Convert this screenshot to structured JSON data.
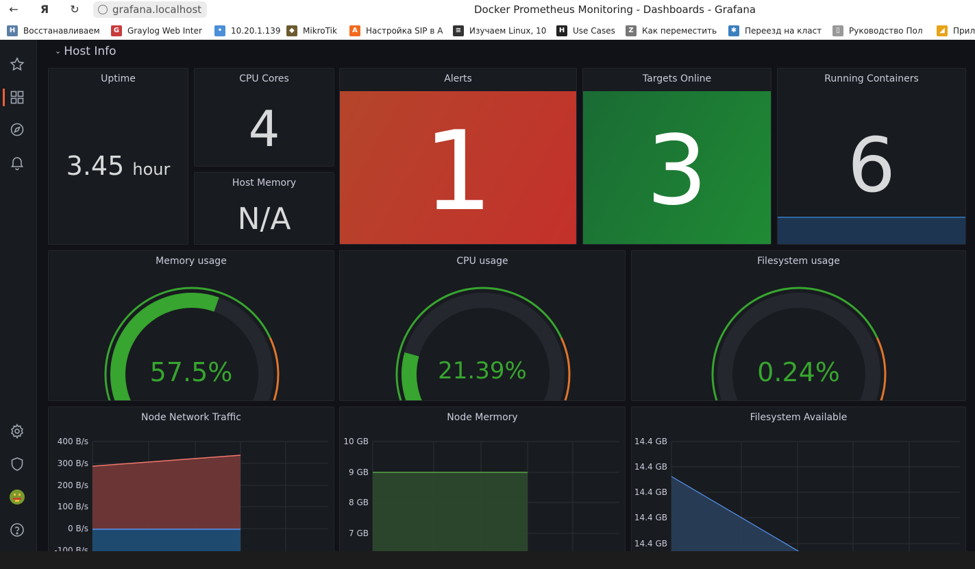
{
  "browser": {
    "url": "grafana.localhost",
    "window_title": "Docker Prometheus Monitoring - Dashboards - Grafana",
    "back_glyph": "←",
    "yandex_glyph": "Я",
    "reload_glyph": "↻"
  },
  "bookmarks": [
    {
      "label": "Восстанавливаем",
      "icon": "H",
      "color": "#5a7fa5"
    },
    {
      "label": "Graylog Web Inter",
      "icon": "G",
      "color": "#c93b3b"
    },
    {
      "label": "10.20.1.139",
      "icon": "•",
      "color": "#4a8fd8"
    },
    {
      "label": "MikroTik",
      "icon": "◆",
      "color": "#6b5b2e"
    },
    {
      "label": "Настройка SIP в А",
      "icon": "A",
      "color": "#f26b1d"
    },
    {
      "label": "Изучаем Linux, 10",
      "icon": "≡",
      "color": "#333333"
    },
    {
      "label": "Use Cases",
      "icon": "H",
      "color": "#222222"
    },
    {
      "label": "Как переместить",
      "icon": "Z",
      "color": "#777777"
    },
    {
      "label": "Переезд на класт",
      "icon": "✱",
      "color": "#3b7fbf"
    },
    {
      "label": "Руководство Пол",
      "icon": "▯",
      "color": "#999999"
    },
    {
      "label": "Прил",
      "icon": "◢",
      "color": "#e8a317"
    }
  ],
  "sidebar": {
    "items": [
      "starred-icon",
      "dashboards-icon",
      "explore-icon",
      "alerting-icon",
      "configuration-icon",
      "server-admin-icon",
      "user-avatar",
      "help-icon"
    ]
  },
  "row": {
    "title": "Host Info",
    "chevron": "⌄"
  },
  "panels": {
    "uptime": {
      "title": "Uptime",
      "value": "3.45",
      "unit": "hour"
    },
    "cpu_cores": {
      "title": "CPU Cores",
      "value": "4"
    },
    "host_memory": {
      "title": "Host Memory",
      "value": "N/A"
    },
    "alerts": {
      "title": "Alerts",
      "value": "1",
      "color": "#c4302b"
    },
    "targets_online": {
      "title": "Targets Online",
      "value": "3",
      "color": "#1f7a34"
    },
    "running_containers": {
      "title": "Running Containers",
      "value": "6"
    },
    "memory_usage": {
      "title": "Memory usage",
      "value": "57.5%",
      "percent": 57.5
    },
    "cpu_usage": {
      "title": "CPU usage",
      "value": "21.39%",
      "percent": 21.39
    },
    "filesystem_usage": {
      "title": "Filesystem usage",
      "value": "0.24%",
      "percent": 0.24
    },
    "network_traffic": {
      "title": "Node Network Traffic",
      "y_ticks": [
        "400 B/s",
        "300 B/s",
        "200 B/s",
        "100 B/s",
        "0 B/s",
        "-100 B/s"
      ]
    },
    "node_memory": {
      "title": "Node Mermory",
      "y_ticks": [
        "10 GB",
        "9 GB",
        "8 GB",
        "7 GB"
      ]
    },
    "filesystem_available": {
      "title": "Filesystem Available",
      "y_ticks": [
        "14.4 GB",
        "14.4 GB",
        "14.4 GB",
        "14.4 GB",
        "14.4 GB"
      ]
    }
  },
  "colors": {
    "gauge_green": "#37a52f",
    "gauge_orange": "#e0752d",
    "gauge_red": "#e02f44",
    "accent": "#f55f3e"
  }
}
